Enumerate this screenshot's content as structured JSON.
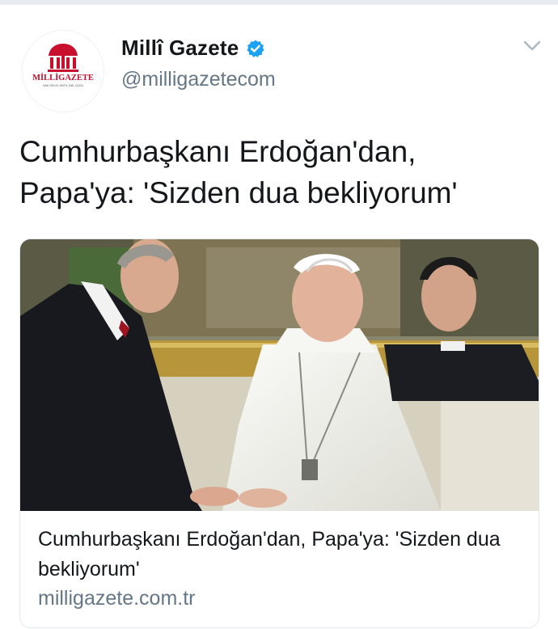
{
  "account": {
    "display_name": "Millî Gazete",
    "handle": "@milligazetecom",
    "verified": true,
    "logo_text": "MİLLİGAZETE",
    "logo_tagline": "HAK GELDİ, BATIL ZAİL OLDU"
  },
  "tweet": {
    "text": "Cumhurbaşkanı Erdoğan'dan, Papa'ya: 'Sizden dua bekliyorum'"
  },
  "card": {
    "title": "Cumhurbaşkanı Erdoğan'dan, Papa'ya: 'Sizden dua bekliyorum'",
    "domain": "milligazete.com.tr"
  },
  "icons": {
    "verified": "verified-badge-icon",
    "menu": "chevron-down-icon"
  },
  "colors": {
    "verified": "#1da1f2",
    "secondary_text": "#657786",
    "brand_red": "#c8102e"
  }
}
